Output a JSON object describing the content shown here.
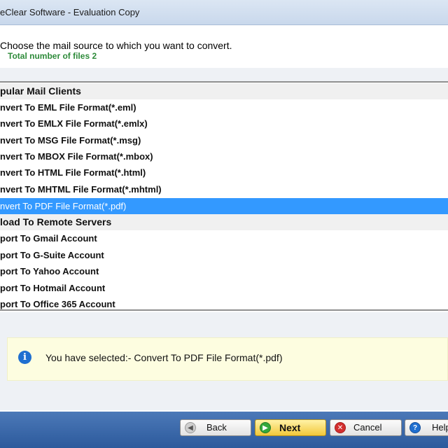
{
  "window": {
    "title": "eClear Software - Evaluation Copy"
  },
  "header": {
    "instruction": "Choose the mail source to which you want to convert.",
    "file_count": "Total number of files 2"
  },
  "options": {
    "groups": [
      {
        "label": "pular Mail Clients",
        "items": [
          "nvert To EML File Format(*.eml)",
          "nvert To EMLX File Format(*.emlx)",
          "nvert To MSG File Format(*.msg)",
          "nvert To MBOX File Format(*.mbox)",
          "nvert To HTML File Format(*.html)",
          "nvert To MHTML File Format(*.mhtml)",
          "nvert To PDF File Format(*.pdf)"
        ]
      },
      {
        "label": "load To Remote Servers",
        "items": [
          "port To Gmail Account",
          "port To G-Suite Account",
          "port To Yahoo Account",
          "port To Hotmail Account",
          "port To Office 365 Account"
        ]
      }
    ],
    "selected_color": "#3399ff"
  },
  "selection": {
    "icon": "info-icon",
    "text": "You have selected:- Convert To PDF File Format(*.pdf)"
  },
  "buttons": {
    "back": {
      "label": "Back",
      "icon": "back-arrow-icon"
    },
    "next": {
      "label": "Next",
      "icon": "next-arrow-icon"
    },
    "cancel": {
      "label": "Cancel",
      "icon": "cancel-x-icon"
    },
    "help": {
      "label": "Help",
      "icon": "help-question-icon"
    }
  }
}
